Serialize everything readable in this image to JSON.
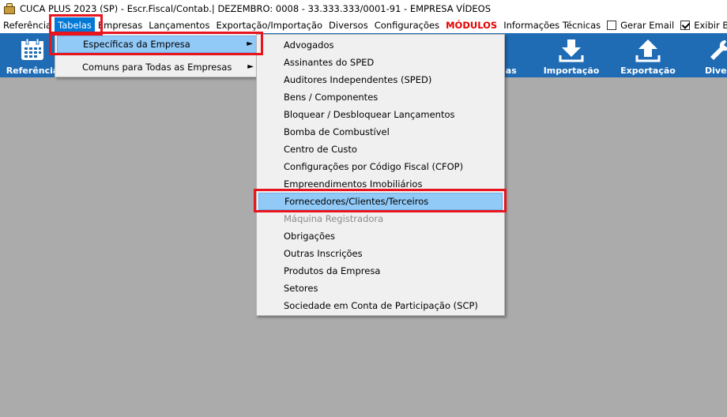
{
  "window": {
    "title": "CUCA PLUS 2023 (SP) - Escr.Fiscal/Contab.| DEZEMBRO: 0008 - 33.333.333/0001-91 - EMPRESA VÍDEOS"
  },
  "menubar": {
    "items": [
      {
        "label": "Referência",
        "active": false
      },
      {
        "label": "Tabelas",
        "active": true
      },
      {
        "label": "Empresas",
        "active": false
      },
      {
        "label": "Lançamentos",
        "active": false
      },
      {
        "label": "Exportação/Importação",
        "active": false
      },
      {
        "label": "Diversos",
        "active": false
      },
      {
        "label": "Configurações",
        "active": false
      },
      {
        "label": "MÓDULOS",
        "active": false
      },
      {
        "label": "Informações Técnicas",
        "active": false
      }
    ],
    "checkboxes": [
      {
        "label": "Gerar Email",
        "checked": false
      },
      {
        "label": "Exibir Barra de",
        "checked": true
      }
    ]
  },
  "toolbar": {
    "buttons": [
      {
        "label": "Referência",
        "icon": "calendar-icon"
      },
      {
        "label": "ias",
        "icon": "none"
      },
      {
        "label": "Importação",
        "icon": "download-arrow-icon"
      },
      {
        "label": "Exportação",
        "icon": "upload-arrow-icon"
      },
      {
        "label": "Diver",
        "icon": "wrench-icon"
      }
    ]
  },
  "tabelas_menu": {
    "items": [
      {
        "label": "Específicas da Empresa",
        "has_submenu": true,
        "active": true
      },
      {
        "label": "Comuns para Todas as Empresas",
        "has_submenu": true,
        "active": false
      }
    ]
  },
  "especificas_submenu": {
    "items": [
      {
        "label": "Advogados"
      },
      {
        "label": "Assinantes do SPED"
      },
      {
        "label": "Auditores Independentes (SPED)"
      },
      {
        "label": "Bens / Componentes"
      },
      {
        "label": "Bloquear / Desbloquear Lançamentos"
      },
      {
        "label": "Bomba de Combustível"
      },
      {
        "label": "Centro de Custo"
      },
      {
        "label": "Configurações por Código Fiscal (CFOP)"
      },
      {
        "label": "Empreendimentos Imobiliários"
      },
      {
        "label": "Fornecedores/Clientes/Terceiros"
      },
      {
        "label": "Máquina Registradora"
      },
      {
        "label": "Obrigações"
      },
      {
        "label": "Outras Inscrições"
      },
      {
        "label": "Produtos da Empresa"
      },
      {
        "label": "Setores"
      },
      {
        "label": "Sociedade em Conta de Participação (SCP)"
      }
    ],
    "active_label": "Fornecedores/Clientes/Terceiros",
    "disabled_label": "Máquina Registradora"
  },
  "colors": {
    "toolbar_bg": "#1f6cb5",
    "menu_active": "#0078d7",
    "item_highlight": "#91c9f7",
    "annotation_red": "#e8141e",
    "desktop_bg": "#ababab"
  }
}
